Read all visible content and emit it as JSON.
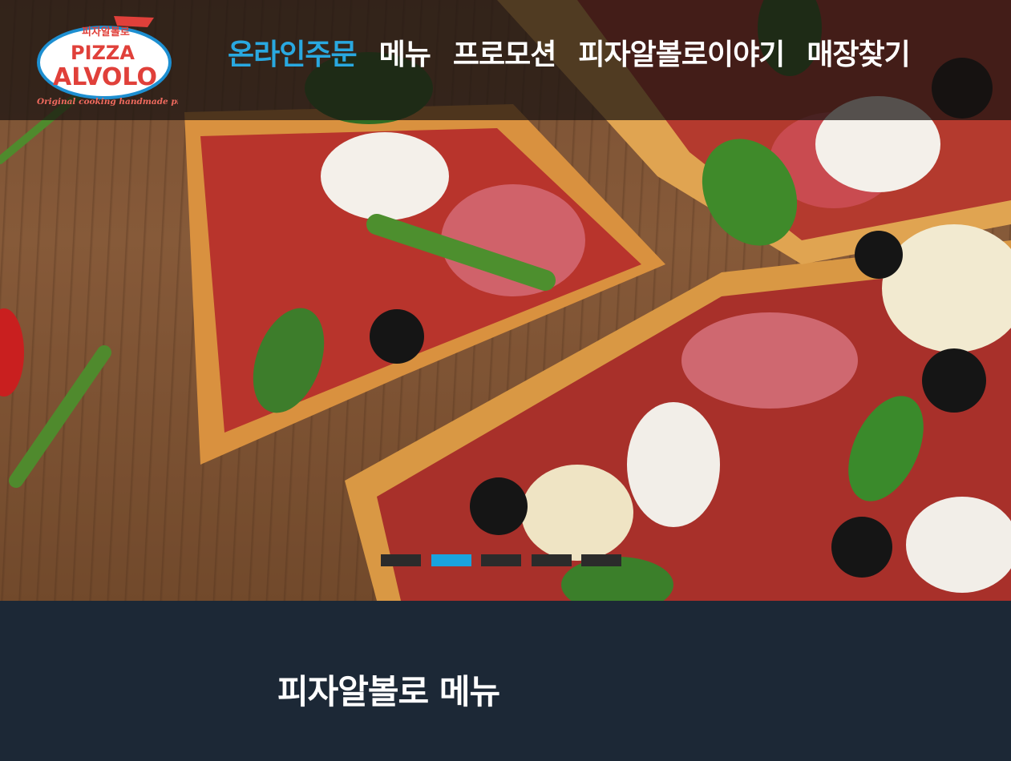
{
  "brand": {
    "logo_top": "피자알볼로",
    "logo_line1": "PIZZA",
    "logo_line2": "ALVOLO",
    "tagline": "Original cooking handmade pizza"
  },
  "nav": {
    "items": [
      {
        "label": "온라인주문",
        "active": true
      },
      {
        "label": "메뉴",
        "active": false
      },
      {
        "label": "프로모션",
        "active": false
      },
      {
        "label": "피자알볼로이야기",
        "active": false
      },
      {
        "label": "매장찾기",
        "active": false
      }
    ]
  },
  "slider": {
    "slide_count": 5,
    "active_index": 1
  },
  "menu_section": {
    "title": "피자알볼로 메뉴"
  },
  "colors": {
    "accent": "#29a8e0",
    "section_bg": "#1c2836",
    "dot_inactive": "#2b2b2b"
  }
}
